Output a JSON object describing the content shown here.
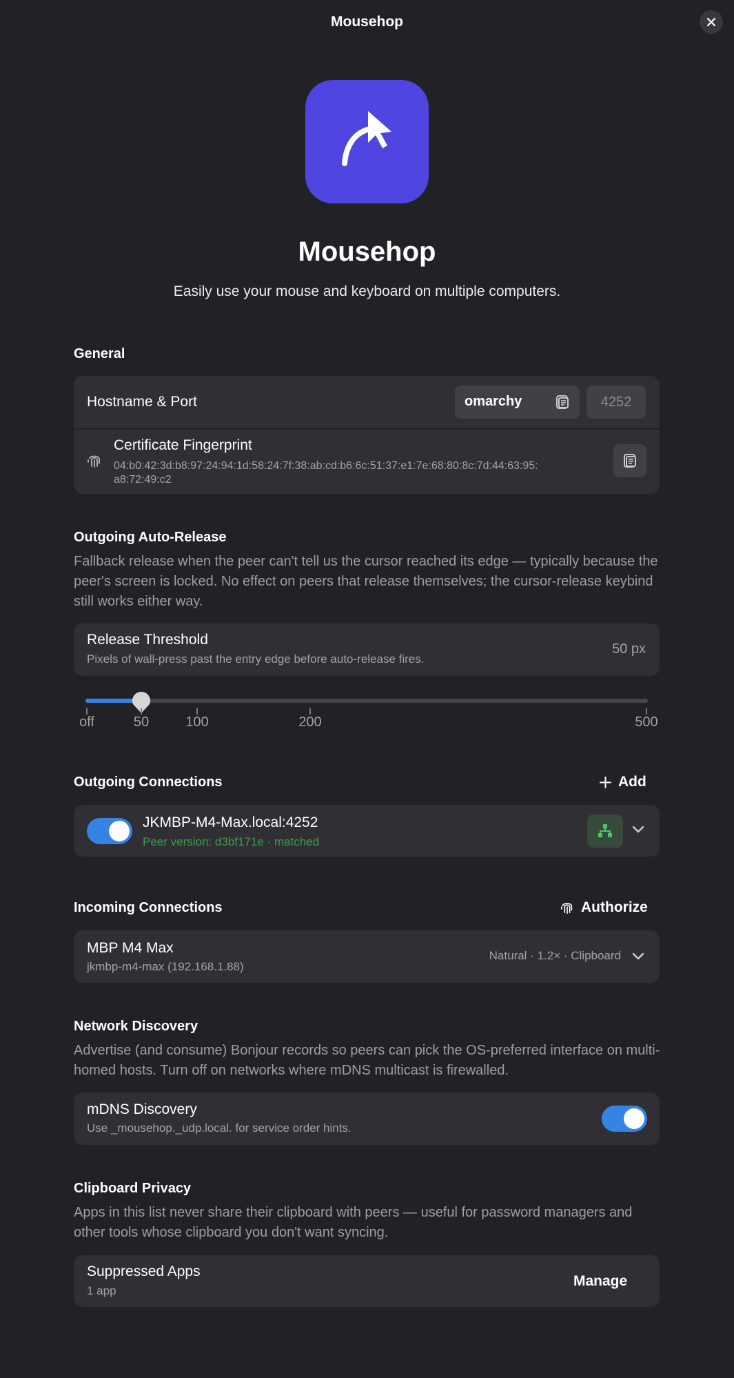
{
  "window": {
    "title": "Mousehop"
  },
  "app": {
    "name": "Mousehop",
    "tagline": "Easily use your mouse and keyboard on multiple computers.",
    "icon": "cursor-hop-icon",
    "icon_color": "#4f46e2"
  },
  "general": {
    "title": "General",
    "hostname_label": "Hostname & Port",
    "hostname": "omarchy",
    "port": "4252",
    "fingerprint_label": "Certificate Fingerprint",
    "fingerprint_line1": "04:b0:42:3d:b8:97:24:94:1d:58:24:7f:38:ab:cd:b6:6c:51:37:e1:7e:68:80:8c:7d:44:63:95:",
    "fingerprint_line2": "a8:72:49:c2"
  },
  "auto_release": {
    "title": "Outgoing Auto-Release",
    "description": "Fallback release when the peer can't tell us the cursor reached its edge — typically because the peer's screen is locked. No effect on peers that release themselves; the cursor-release keybind still works either way.",
    "threshold_label": "Release Threshold",
    "threshold_sub": "Pixels of wall-press past the entry edge before auto-release fires.",
    "threshold_value": "50 px",
    "slider": {
      "value": 50,
      "max": 500,
      "marks": [
        {
          "value": 0,
          "label": "off"
        },
        {
          "value": 50,
          "label": "50"
        },
        {
          "value": 100,
          "label": "100"
        },
        {
          "value": 200,
          "label": "200"
        },
        {
          "value": 500,
          "label": "500"
        }
      ]
    }
  },
  "outgoing": {
    "title": "Outgoing Connections",
    "add_label": "Add",
    "connections": [
      {
        "host": "JKMBP-M4-Max.local:4252",
        "status": "Peer version: d3bf171e · matched",
        "enabled": true
      }
    ]
  },
  "incoming": {
    "title": "Incoming Connections",
    "authorize_label": "Authorize",
    "connections": [
      {
        "name": "MBP M4 Max",
        "address": "jkmbp-m4-max (192.168.1.88)",
        "summary": "Natural · 1.2× · Clipboard"
      }
    ]
  },
  "network": {
    "title": "Network Discovery",
    "description": "Advertise (and consume) Bonjour records so peers can pick the OS-preferred interface on multi-homed hosts. Turn off on networks where mDNS multicast is firewalled.",
    "mdns_label": "mDNS Discovery",
    "mdns_sub": "Use _mousehop._udp.local. for service order hints.",
    "mdns_enabled": true
  },
  "clipboard": {
    "title": "Clipboard Privacy",
    "description": "Apps in this list never share their clipboard with peers — useful for password managers and other tools whose clipboard you don't want syncing.",
    "suppressed_label": "Suppressed Apps",
    "suppressed_count": "1 app",
    "manage_label": "Manage"
  },
  "colors": {
    "background": "#222226",
    "card": "#303034",
    "accent": "#3584e4",
    "success": "#3e9a4c"
  }
}
